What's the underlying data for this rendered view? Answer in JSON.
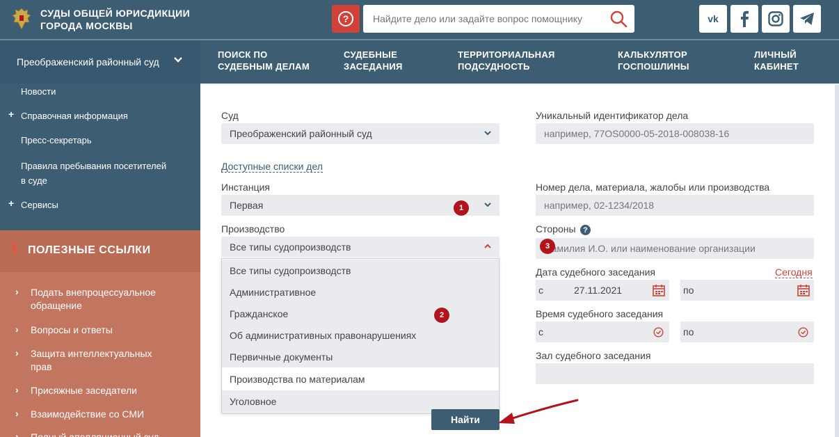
{
  "header": {
    "title_line1": "СУДЫ ОБЩЕЙ ЮРИСДИКЦИИ",
    "title_line2": "ГОРОДА МОСКВЫ",
    "help_icon": "question-circle-icon",
    "search_placeholder": "Найдите дело или задайте вопрос помощнику",
    "social": [
      "vk-icon",
      "facebook-icon",
      "instagram-icon",
      "telegram-icon"
    ]
  },
  "court_selector": {
    "label": "Преображенский районный суд"
  },
  "topnav": [
    {
      "line1": "ПОИСК ПО",
      "line2": "СУДЕБНЫМ ДЕЛАМ"
    },
    {
      "line1": "СУДЕБНЫЕ",
      "line2": "ЗАСЕДАНИЯ"
    },
    {
      "line1": "ТЕРРИТОРИАЛЬНАЯ",
      "line2": "ПОДСУДНОСТЬ"
    },
    {
      "line1": "КАЛЬКУЛЯТОР",
      "line2": "ГОСПОШЛИНЫ"
    },
    {
      "line1": "ЛИЧНЫЙ",
      "line2": "КАБИНЕТ"
    }
  ],
  "sidebar": {
    "items": [
      {
        "label": "Новости",
        "plus": ""
      },
      {
        "label": "Справочная информация",
        "plus": "+"
      },
      {
        "label": "Пресс-секретарь",
        "plus": ""
      },
      {
        "label_line1": "Правила пребывания посетителей",
        "label_line2": "в суде",
        "plus": ""
      },
      {
        "label": "Сервисы",
        "plus": "+"
      }
    ],
    "useful_title": "ПОЛЕЗНЫЕ ССЫЛКИ",
    "useful_links": [
      {
        "line1": "Подать внепроцессуальное",
        "line2": "обращение"
      },
      {
        "line1": "Вопросы и ответы",
        "line2": ""
      },
      {
        "line1": "Защита интеллектуальных",
        "line2": "прав"
      },
      {
        "line1": "Присяжные заседатели",
        "line2": ""
      },
      {
        "line1": "Взаимодействие со СМИ",
        "line2": ""
      },
      {
        "line1": "Полный апелляционный суд",
        "line2": ""
      }
    ]
  },
  "form": {
    "court_label": "Суд",
    "court_value": "Преображенский районный суд",
    "available_lists": "Доступные списки дел",
    "instance_label": "Инстанция",
    "instance_value": "Первая",
    "production_label": "Производство",
    "production_value": "Все типы судопроизводств",
    "production_options": [
      "Все типы судопроизводств",
      "Административное",
      "Гражданское",
      "Об административных правонарушениях",
      "Первичные документы",
      "Производства по материалам",
      "Уголовное"
    ],
    "uid_label": "Уникальный идентификатор дела",
    "uid_placeholder": "например, 77OS0000-05-2018-008038-16",
    "case_number_label": "Номер дела, материала, жалобы или производства",
    "case_number_placeholder": "например, 02-1234/2018",
    "parties_label": "Стороны",
    "parties_placeholder": "Фамилия И.О. или наименование организации",
    "date_label": "Дата судебного заседания",
    "today_link": "Сегодня",
    "date_from_prefix": "с",
    "date_from_value": "27.11.2021",
    "date_to_prefix": "по",
    "time_label": "Время судебного заседания",
    "time_from_prefix": "с",
    "time_to_prefix": "по",
    "hall_label": "Зал судебного заседания",
    "submit": "Найти"
  },
  "annotations": {
    "badge1": "1",
    "badge2": "2",
    "badge3": "3",
    "arrow_color": "#b3141b"
  },
  "colors": {
    "header": "#3d5d73",
    "useful_head": "#b96b53",
    "useful_list": "#c27660",
    "accent_red": "#d2403a",
    "field_bg": "#e9ebee"
  }
}
